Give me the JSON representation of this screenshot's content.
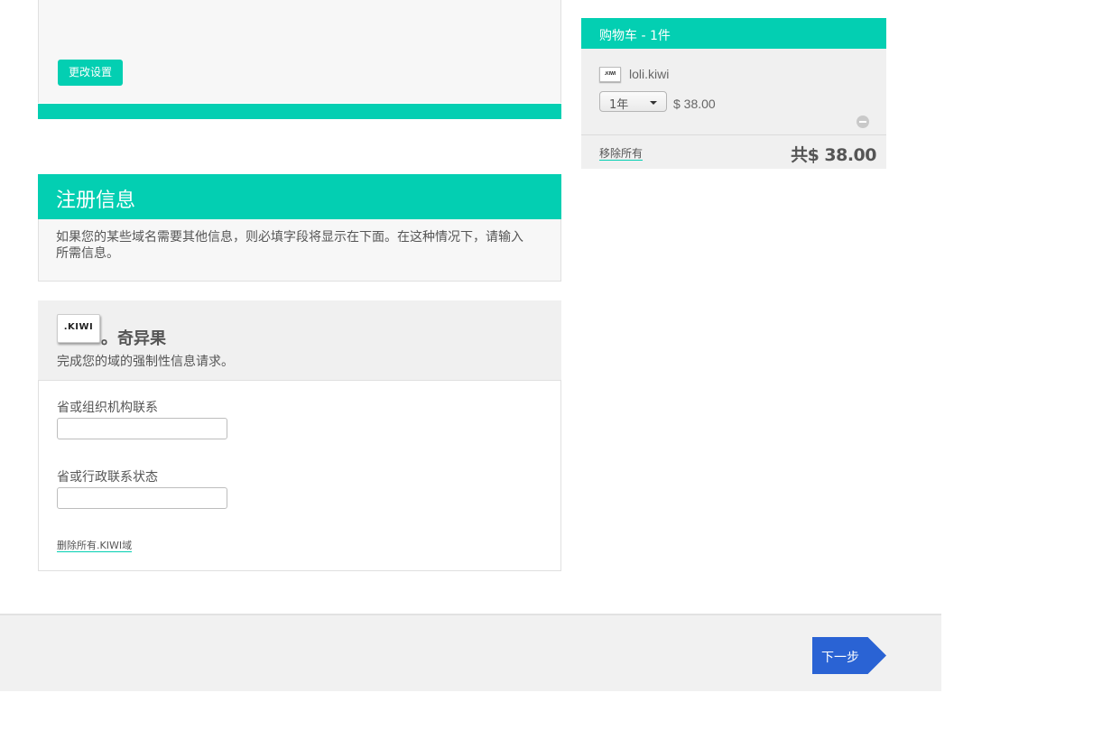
{
  "settings": {
    "change_button_label": "更改设置"
  },
  "registration": {
    "title": "注册信息",
    "description": "如果您的某些域名需要其他信息，则必填字段将显示在下面。在这种情况下，请输入所需信息。"
  },
  "kiwi_section": {
    "logo_text": ".KIWI",
    "title": "。奇异果",
    "subtitle": "完成您的域的强制性信息请求。",
    "fields": [
      {
        "label": "省或组织机构联系",
        "value": ""
      },
      {
        "label": "省或行政联系状态",
        "value": ""
      }
    ],
    "remove_link": "删除所有.KIWI域"
  },
  "cart": {
    "title": "购物车 - 1件",
    "item": {
      "logo_text": ".KIWI",
      "domain": "loli.kiwi",
      "term": "1年",
      "price": "$ 38.00"
    },
    "remove_all": "移除所有",
    "total": "共$ 38.00"
  },
  "footer": {
    "next_label": "下一步"
  },
  "colors": {
    "accent": "#03cfb2",
    "next_button": "#2a63d4"
  }
}
